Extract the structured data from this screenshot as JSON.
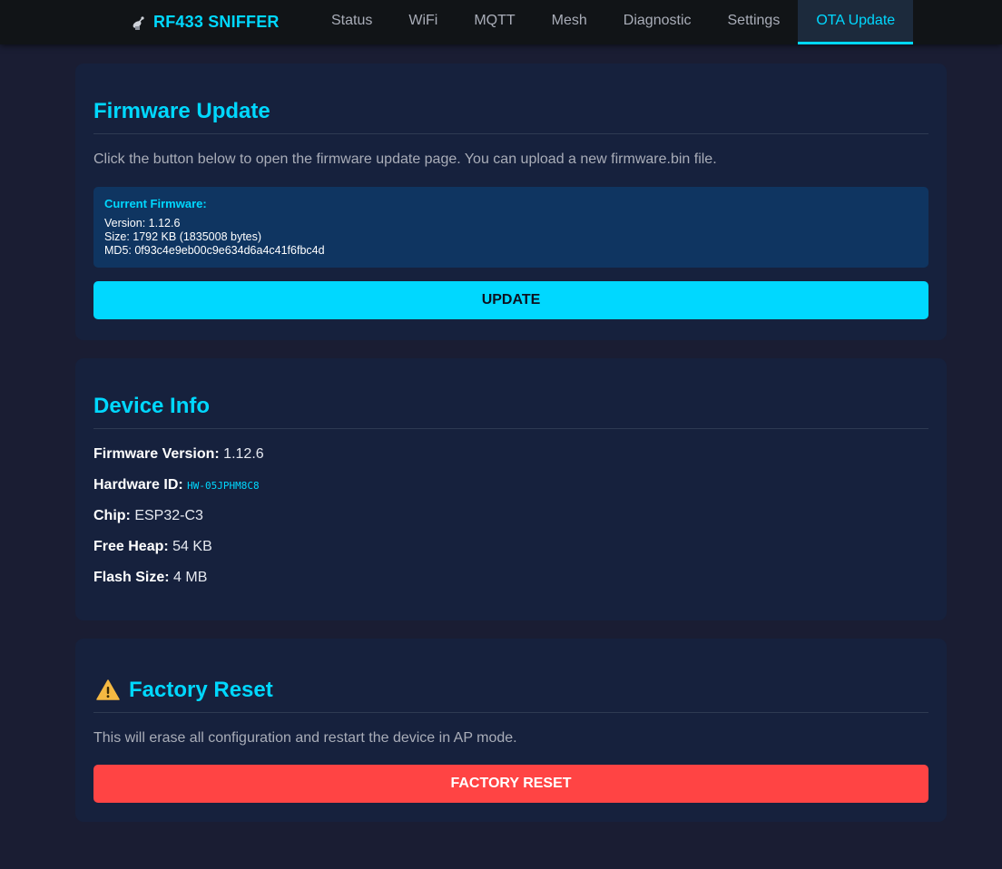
{
  "header": {
    "brand": "RF433 SNIFFER",
    "brand_icon": "satellite-antenna-icon",
    "tabs": [
      {
        "label": "Status"
      },
      {
        "label": "WiFi"
      },
      {
        "label": "MQTT"
      },
      {
        "label": "Mesh"
      },
      {
        "label": "Diagnostic"
      },
      {
        "label": "Settings"
      },
      {
        "label": "OTA Update"
      }
    ],
    "active_tab": "OTA Update"
  },
  "firmware_update": {
    "title": "Firmware Update",
    "description": "Click the button below to open the firmware update page. You can upload a new firmware.bin file.",
    "current_firmware_heading": "Current Firmware:",
    "version_line": "Version: 1.12.6",
    "size_line": "Size: 1792 KB (1835008 bytes)",
    "md5_line": "MD5: 0f93c4e9eb00c9e634d6a4c41f6fbc4d",
    "button_label": "UPDATE"
  },
  "device_info": {
    "title": "Device Info",
    "rows": [
      {
        "label": "Firmware Version:",
        "value": "1.12.6"
      },
      {
        "label": "Hardware ID:",
        "value": "HW-05JPHM8C8"
      },
      {
        "label": "Chip:",
        "value": "ESP32-C3"
      },
      {
        "label": "Free Heap:",
        "value": "54 KB"
      },
      {
        "label": "Flash Size:",
        "value": "4 MB"
      }
    ]
  },
  "factory_reset": {
    "title": "Factory Reset",
    "icon": "warning-icon",
    "description": "This will erase all configuration and restart the device in AP mode.",
    "button_label": "FACTORY RESET"
  },
  "colors": {
    "accent": "#00d8ff",
    "danger": "#ff4444",
    "background": "#1a1d33",
    "card": "#16213d"
  }
}
